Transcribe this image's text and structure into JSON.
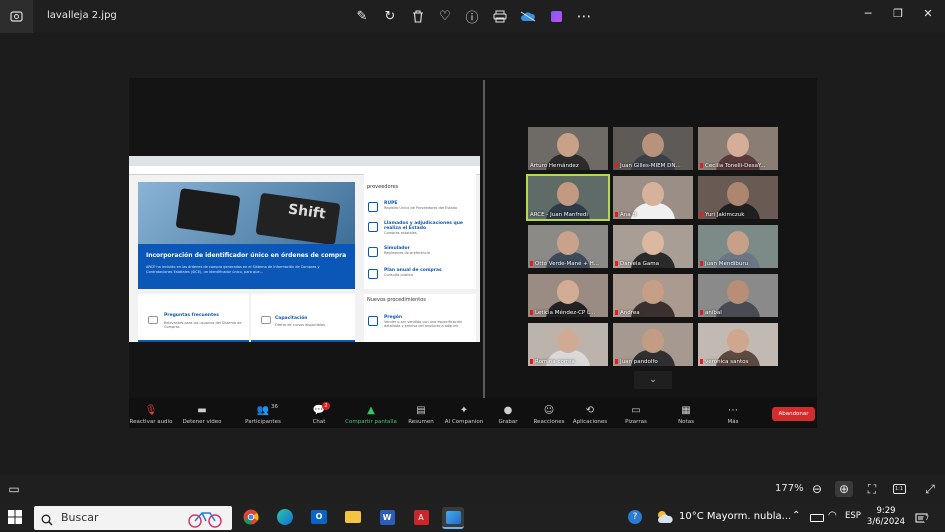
{
  "viewer": {
    "filename": "lavalleja 2.jpg",
    "toolbar_icons": [
      "edit-icon",
      "rotate-icon",
      "delete-icon",
      "favorite-icon",
      "info-icon",
      "print-icon",
      "onedrive-icon",
      "clipchamp-icon",
      "more-icon"
    ],
    "zoom_level": "177%"
  },
  "shared_screen": {
    "hero_title": "Incorporación de identificador único en órdenes de compra",
    "hero_text": "ARCE ha incluido en las órdenes de compra generadas en el Sistema de Información de Compras y Contrataciones Estatales (SICE), un identificador único, para que...",
    "hero_key_label": "Shift",
    "side_heading": "proveedores",
    "side_items": [
      {
        "title": "RUPE",
        "sub": "Registro Único de Proveedores del Estado"
      },
      {
        "title": "Llamados y adjudicaciones que realiza el Estado",
        "sub": "Compras estatales"
      },
      {
        "title": "Simulador",
        "sub": "Regímenes de preferencia"
      },
      {
        "title": "Plan anual de compras",
        "sub": "Consulta pública"
      }
    ],
    "cards": [
      {
        "title": "Preguntas frecuentes",
        "sub": "Relevantes para los usuarios del Sistema de Compras"
      },
      {
        "title": "Capacitación",
        "sub": "Oferta de cursos disponibles"
      }
    ],
    "nuevos_heading": "Nuevos procedimientos",
    "nuevos_item": {
      "title": "Pregón",
      "sub": "Vender o ser vendido con una especificación detallada y precisa del producto a adquirir"
    }
  },
  "participants": [
    {
      "name": "Arturo Hernández",
      "muted": false
    },
    {
      "name": "Juan Gilles-MIEM DN...",
      "muted": true
    },
    {
      "name": "Cecilia Tonelli-DesaY...",
      "muted": true
    },
    {
      "name": "ARCE - Juan Manfredi",
      "muted": false,
      "active": true
    },
    {
      "name": "Ana H",
      "muted": true
    },
    {
      "name": "Yuri Jakimczuk",
      "muted": true
    },
    {
      "name": "Otto Verde-Mané + H...",
      "muted": true
    },
    {
      "name": "Daniela Gama",
      "muted": true
    },
    {
      "name": "Juan Mendiburu",
      "muted": true
    },
    {
      "name": "Leticia Méndez-CP L...",
      "muted": true
    },
    {
      "name": "Andrea",
      "muted": true
    },
    {
      "name": "anibal",
      "muted": true
    },
    {
      "name": "Romina correa",
      "muted": true
    },
    {
      "name": "Juan pandolfo",
      "muted": true
    },
    {
      "name": "verónica santos",
      "muted": true
    }
  ],
  "zoom_toolbar": [
    {
      "label": "Reactivar audio",
      "icon": "mic-muted-icon"
    },
    {
      "label": "Detener video",
      "icon": "video-icon"
    },
    {
      "label": "Participantes",
      "icon": "participants-icon",
      "count": "36"
    },
    {
      "label": "Chat",
      "icon": "chat-icon",
      "badge": "2"
    },
    {
      "label": "Compartir pantalla",
      "icon": "share-screen-icon"
    },
    {
      "label": "Resumen",
      "icon": "summary-icon"
    },
    {
      "label": "AI Companion",
      "icon": "ai-icon"
    },
    {
      "label": "Grabar",
      "icon": "record-icon"
    },
    {
      "label": "Reacciones",
      "icon": "reactions-icon"
    },
    {
      "label": "Aplicaciones",
      "icon": "apps-icon"
    },
    {
      "label": "Pizarras",
      "icon": "whiteboard-icon"
    },
    {
      "label": "Notas",
      "icon": "notes-icon"
    },
    {
      "label": "Más",
      "icon": "more-icon"
    }
  ],
  "leave_button": "Abandonar",
  "taskbar": {
    "search_placeholder": "Buscar",
    "weather": "10°C  Mayorm. nubla...",
    "language": "ESP",
    "time": "9:29",
    "date": "3/6/2024",
    "notification_count": "7"
  },
  "colors": {
    "accent_blue": "#0b57b8",
    "leave_red": "#d22c2c",
    "share_green": "#33c96a",
    "active_speaker": "#b7d94c"
  }
}
